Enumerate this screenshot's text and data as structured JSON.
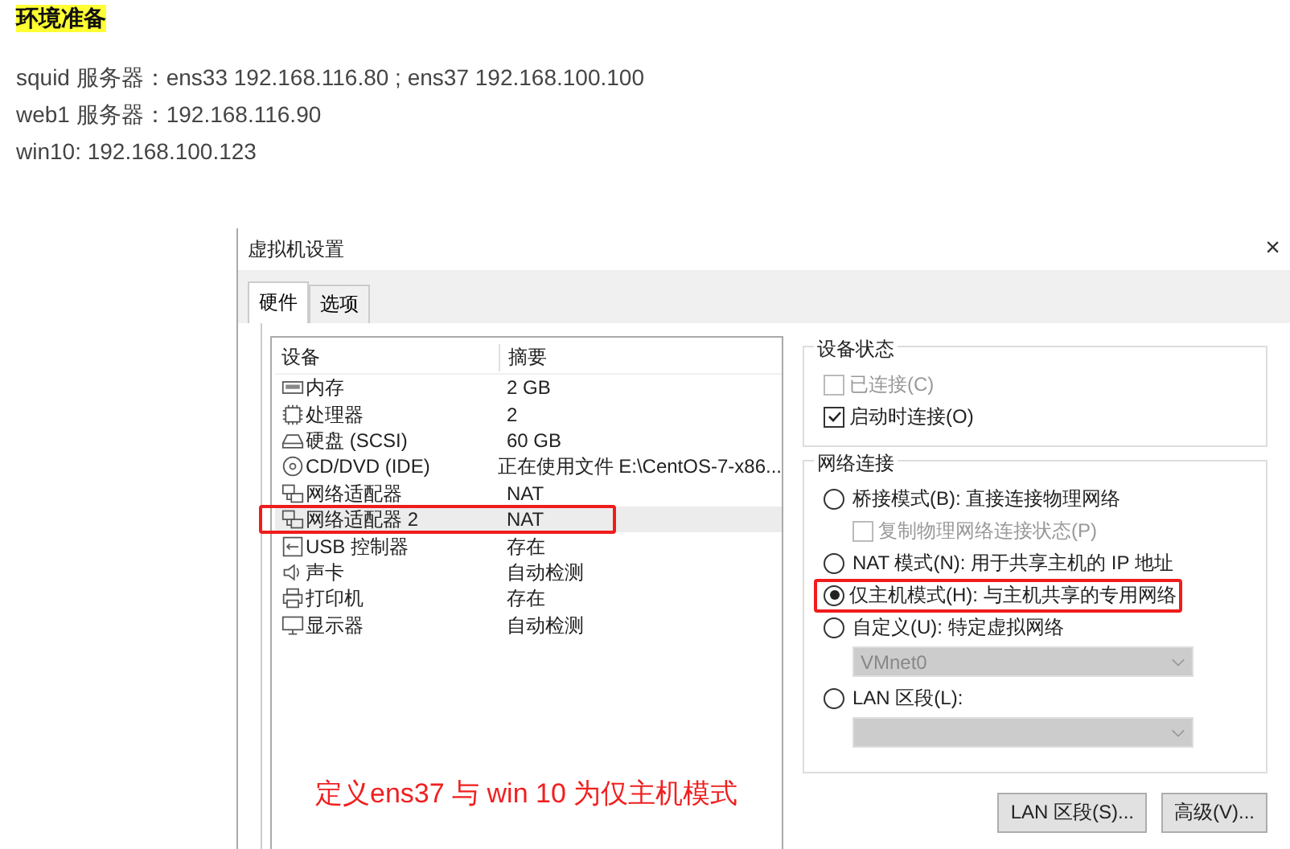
{
  "article": {
    "heading": "环境准备",
    "lines": [
      "squid 服务器：ens33 192.168.116.80 ; ens37 192.168.100.100",
      "web1 服务器：192.168.116.90",
      "win10: 192.168.100.123"
    ]
  },
  "dialog": {
    "title": "虚拟机设置",
    "close": "×",
    "tabs": [
      {
        "label": "硬件",
        "selected": true
      },
      {
        "label": "选项",
        "selected": false
      }
    ],
    "device_list": {
      "columns": [
        "设备",
        "摘要"
      ],
      "rows": [
        {
          "kind": "memory",
          "device": "内存",
          "summary": "2 GB",
          "highlighted": false
        },
        {
          "kind": "cpu",
          "device": "处理器",
          "summary": "2",
          "highlighted": false
        },
        {
          "kind": "disk",
          "device": "硬盘 (SCSI)",
          "summary": "60 GB",
          "highlighted": false
        },
        {
          "kind": "cd",
          "device": "CD/DVD (IDE)",
          "summary": "正在使用文件 E:\\CentOS-7-x86...",
          "highlighted": false
        },
        {
          "kind": "network",
          "device": "网络适配器",
          "summary": "NAT",
          "highlighted": false
        },
        {
          "kind": "network",
          "device": "网络适配器 2",
          "summary": "NAT",
          "highlighted": true
        },
        {
          "kind": "usb",
          "device": "USB 控制器",
          "summary": "存在",
          "highlighted": false
        },
        {
          "kind": "sound",
          "device": "声卡",
          "summary": "自动检测",
          "highlighted": false
        },
        {
          "kind": "printer",
          "device": "打印机",
          "summary": "存在",
          "highlighted": false
        },
        {
          "kind": "display",
          "device": "显示器",
          "summary": "自动检测",
          "highlighted": false
        }
      ]
    },
    "device_status": {
      "title": "设备状态",
      "options": [
        {
          "label": "已连接(C)",
          "checked": false,
          "disabled": true
        },
        {
          "label": "启动时连接(O)",
          "checked": true,
          "disabled": false
        }
      ]
    },
    "network_connection": {
      "title": "网络连接",
      "items": [
        {
          "kind": "radio",
          "label": "桥接模式(B): 直接连接物理网络",
          "selected": false,
          "highlighted": false
        },
        {
          "kind": "checkbox",
          "label": "复制物理网络连接状态(P)",
          "checked": false,
          "disabled": true
        },
        {
          "kind": "radio",
          "label": "NAT 模式(N): 用于共享主机的 IP 地址",
          "selected": false,
          "highlighted": false
        },
        {
          "kind": "radio",
          "label": "仅主机模式(H): 与主机共享的专用网络",
          "selected": true,
          "highlighted": true
        },
        {
          "kind": "radio",
          "label": "自定义(U): 特定虚拟网络",
          "selected": false,
          "highlighted": false
        },
        {
          "kind": "dropdown",
          "value": "VMnet0",
          "disabled": true
        },
        {
          "kind": "radio",
          "label": "LAN 区段(L):",
          "selected": false,
          "highlighted": false
        },
        {
          "kind": "dropdown",
          "disabled": true
        }
      ]
    },
    "buttons": [
      "LAN 区段(S)...",
      "高级(V)..."
    ],
    "annotation": "定义ens37 与 win 10 为仅主机模式"
  }
}
